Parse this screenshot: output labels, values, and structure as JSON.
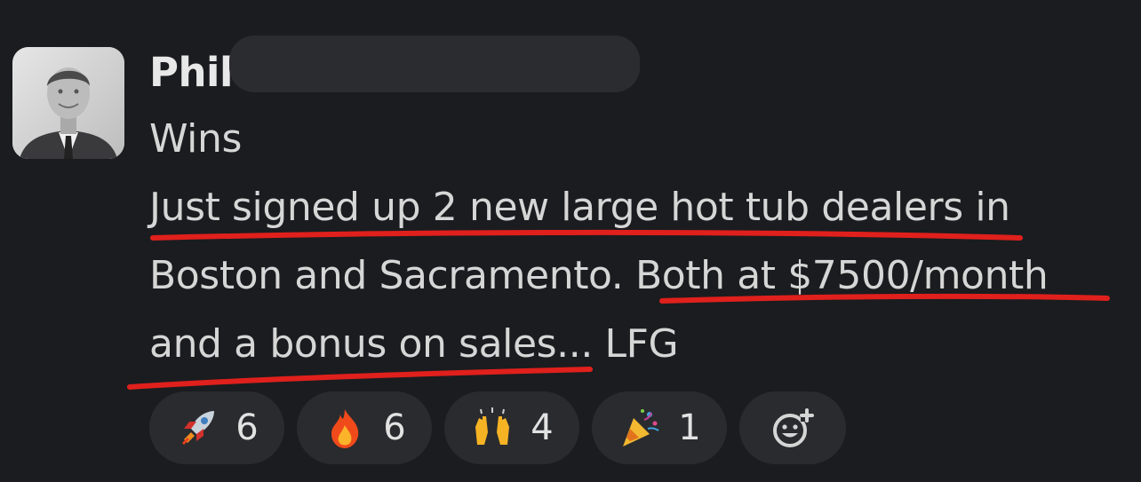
{
  "message": {
    "author": "Phil",
    "channel_label": "Wins",
    "lines": [
      "Just signed up 2 new large hot tub dealers in",
      "Boston and Sacramento. Both at $7500/month",
      "and a bonus on sales... LFG"
    ]
  },
  "reactions": [
    {
      "icon": "rocket-emoji",
      "count": "6"
    },
    {
      "icon": "fire-emoji",
      "count": "6"
    },
    {
      "icon": "raised-hands-emoji",
      "count": "4"
    },
    {
      "icon": "party-popper-emoji",
      "count": "1"
    }
  ],
  "add_reaction": {
    "icon": "add-emoji-icon"
  },
  "colors": {
    "background": "#1b1c1f",
    "pill": "#2a2b2e",
    "underline": "#e0201c",
    "text": "#d6d6d7"
  }
}
